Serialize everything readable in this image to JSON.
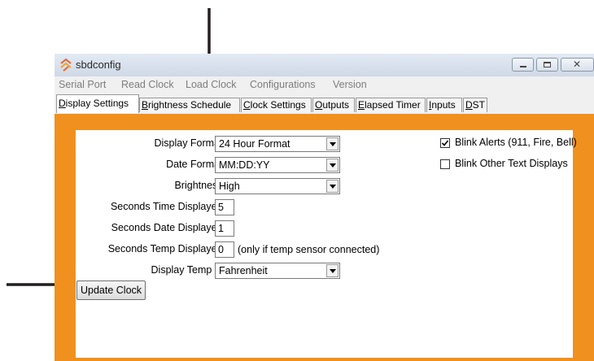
{
  "window": {
    "title": "sbdconfig"
  },
  "menu": [
    "Serial Port",
    "Read Clock",
    "Load Clock",
    "Configurations",
    "Version"
  ],
  "tabs": [
    {
      "mn": "D",
      "rest": "isplay Settings"
    },
    {
      "mn": "B",
      "rest": "rightness Schedule"
    },
    {
      "mn": "C",
      "rest": "lock Settings"
    },
    {
      "mn": "O",
      "rest": "utputs"
    },
    {
      "mn": "E",
      "rest": "lapsed Timer"
    },
    {
      "mn": "I",
      "rest": "nputs"
    },
    {
      "mn": "D",
      "rest": "ST"
    }
  ],
  "form": {
    "display_format": {
      "label": "Display Format:",
      "value": "24 Hour Format"
    },
    "date_format": {
      "label": "Date Format:",
      "value": "MM:DD:YY"
    },
    "brightness": {
      "label": "Brightness:",
      "value": "High"
    },
    "seconds_time": {
      "label": "Seconds Time Displayed:",
      "value": "5"
    },
    "seconds_date": {
      "label": "Seconds Date Displayed:",
      "value": "1"
    },
    "seconds_temp": {
      "label": "Seconds Temp Displayed:",
      "value": "0",
      "note": "(only if temp sensor connected)"
    },
    "temp_unit": {
      "label": "Display Temp in:",
      "value": "Fahrenheit"
    },
    "update_button": "Update Clock"
  },
  "checkboxes": {
    "blink_alerts": {
      "label": "Blink Alerts (911, Fire, Bell)",
      "checked": true
    },
    "blink_other": {
      "label": "Blink Other Text Displays",
      "checked": false
    }
  },
  "colors": {
    "accent": "#f0911f",
    "arrow": "#231f20"
  }
}
